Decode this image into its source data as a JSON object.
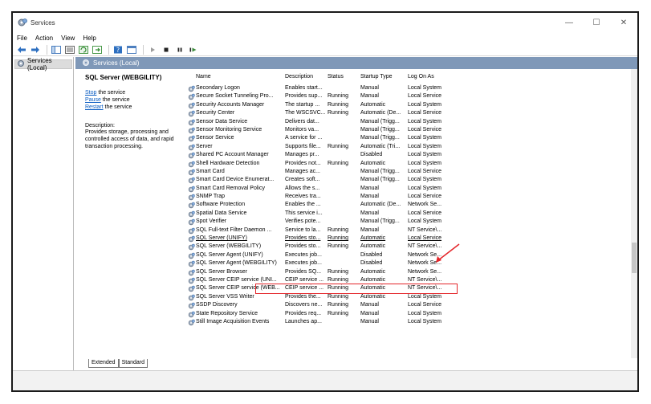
{
  "window": {
    "title": "Services",
    "min": "—",
    "max": "☐",
    "close": "✕"
  },
  "menu": [
    "File",
    "Action",
    "View",
    "Help"
  ],
  "tree": {
    "root": "Services (Local)"
  },
  "pane": {
    "header": "Services (Local)"
  },
  "details": {
    "service_name": "SQL Server (WEBGILITY)",
    "stop_link": "Stop",
    "stop_rest": " the service",
    "pause_link": "Pause",
    "pause_rest": " the service",
    "restart_link": "Restart",
    "restart_rest": " the service",
    "description_label": "Description:",
    "description_text": "Provides storage, processing and controlled access of data, and rapid transaction processing."
  },
  "columns": {
    "name": "Name",
    "description": "Description",
    "status": "Status",
    "startup": "Startup Type",
    "logon": "Log On As"
  },
  "rows": [
    [
      "Secondary Logon",
      "Enables start...",
      "",
      "Manual",
      "Local System"
    ],
    [
      "Secure Socket Tunneling Pro...",
      "Provides sup...",
      "Running",
      "Manual",
      "Local Service"
    ],
    [
      "Security Accounts Manager",
      "The startup ...",
      "Running",
      "Automatic",
      "Local System"
    ],
    [
      "Security Center",
      "The WSCSVC...",
      "Running",
      "Automatic (De...",
      "Local Service"
    ],
    [
      "Sensor Data Service",
      "Delivers dat...",
      "",
      "Manual (Trigg...",
      "Local System"
    ],
    [
      "Sensor Monitoring Service",
      "Monitors va...",
      "",
      "Manual (Trigg...",
      "Local Service"
    ],
    [
      "Sensor Service",
      "A service for ...",
      "",
      "Manual (Trigg...",
      "Local System"
    ],
    [
      "Server",
      "Supports file...",
      "Running",
      "Automatic (Tri...",
      "Local System"
    ],
    [
      "Shared PC Account Manager",
      "Manages pr...",
      "",
      "Disabled",
      "Local System"
    ],
    [
      "Shell Hardware Detection",
      "Provides not...",
      "Running",
      "Automatic",
      "Local System"
    ],
    [
      "Smart Card",
      "Manages ac...",
      "",
      "Manual (Trigg...",
      "Local Service"
    ],
    [
      "Smart Card Device Enumerat...",
      "Creates soft...",
      "",
      "Manual (Trigg...",
      "Local System"
    ],
    [
      "Smart Card Removal Policy",
      "Allows the s...",
      "",
      "Manual",
      "Local System"
    ],
    [
      "SNMP Trap",
      "Receives tra...",
      "",
      "Manual",
      "Local Service"
    ],
    [
      "Software Protection",
      "Enables the ...",
      "",
      "Automatic (De...",
      "Network Se..."
    ],
    [
      "Spatial Data Service",
      "This service i...",
      "",
      "Manual",
      "Local Service"
    ],
    [
      "Spot Verifier",
      "Verifies pote...",
      "",
      "Manual (Trigg...",
      "Local System"
    ],
    [
      "SQL Full-text Filter Daemon ...",
      "Service to la...",
      "Running",
      "Manual",
      "NT Service\\..."
    ],
    [
      "SQL Server (UNIFY)",
      "Provides sto...",
      "Running",
      "Automatic",
      "Local Service"
    ],
    [
      "SQL Server (WEBGILITY)",
      "Provides sto...",
      "Running",
      "Automatic",
      "NT Service\\..."
    ],
    [
      "SQL Server Agent (UNIFY)",
      "Executes job...",
      "",
      "Disabled",
      "Network Se..."
    ],
    [
      "SQL Server Agent (WEBGILITY)",
      "Executes job...",
      "",
      "Disabled",
      "Network Se..."
    ],
    [
      "SQL Server Browser",
      "Provides SQ...",
      "Running",
      "Automatic",
      "Network Se..."
    ],
    [
      "SQL Server CEIP service (UNI...",
      "CEIP service ...",
      "Running",
      "Automatic",
      "NT Service\\..."
    ],
    [
      "SQL Server CEIP service (WEB...",
      "CEIP service ...",
      "Running",
      "Automatic",
      "NT Service\\..."
    ],
    [
      "SQL Server VSS Writer",
      "Provides the...",
      "Running",
      "Automatic",
      "Local System"
    ],
    [
      "SSDP Discovery",
      "Discovers ne...",
      "Running",
      "Manual",
      "Local Service"
    ],
    [
      "State Repository Service",
      "Provides req...",
      "Running",
      "Manual",
      "Local System"
    ],
    [
      "Still Image Acquisition Events",
      "Launches ap...",
      "",
      "Manual",
      "Local System"
    ]
  ],
  "highlighted_row": 19,
  "tabs": [
    "Extended",
    "Standard"
  ],
  "colors": {
    "header": "#7f98b8",
    "link": "#0a5cc2",
    "highlight": "#e4262a"
  }
}
